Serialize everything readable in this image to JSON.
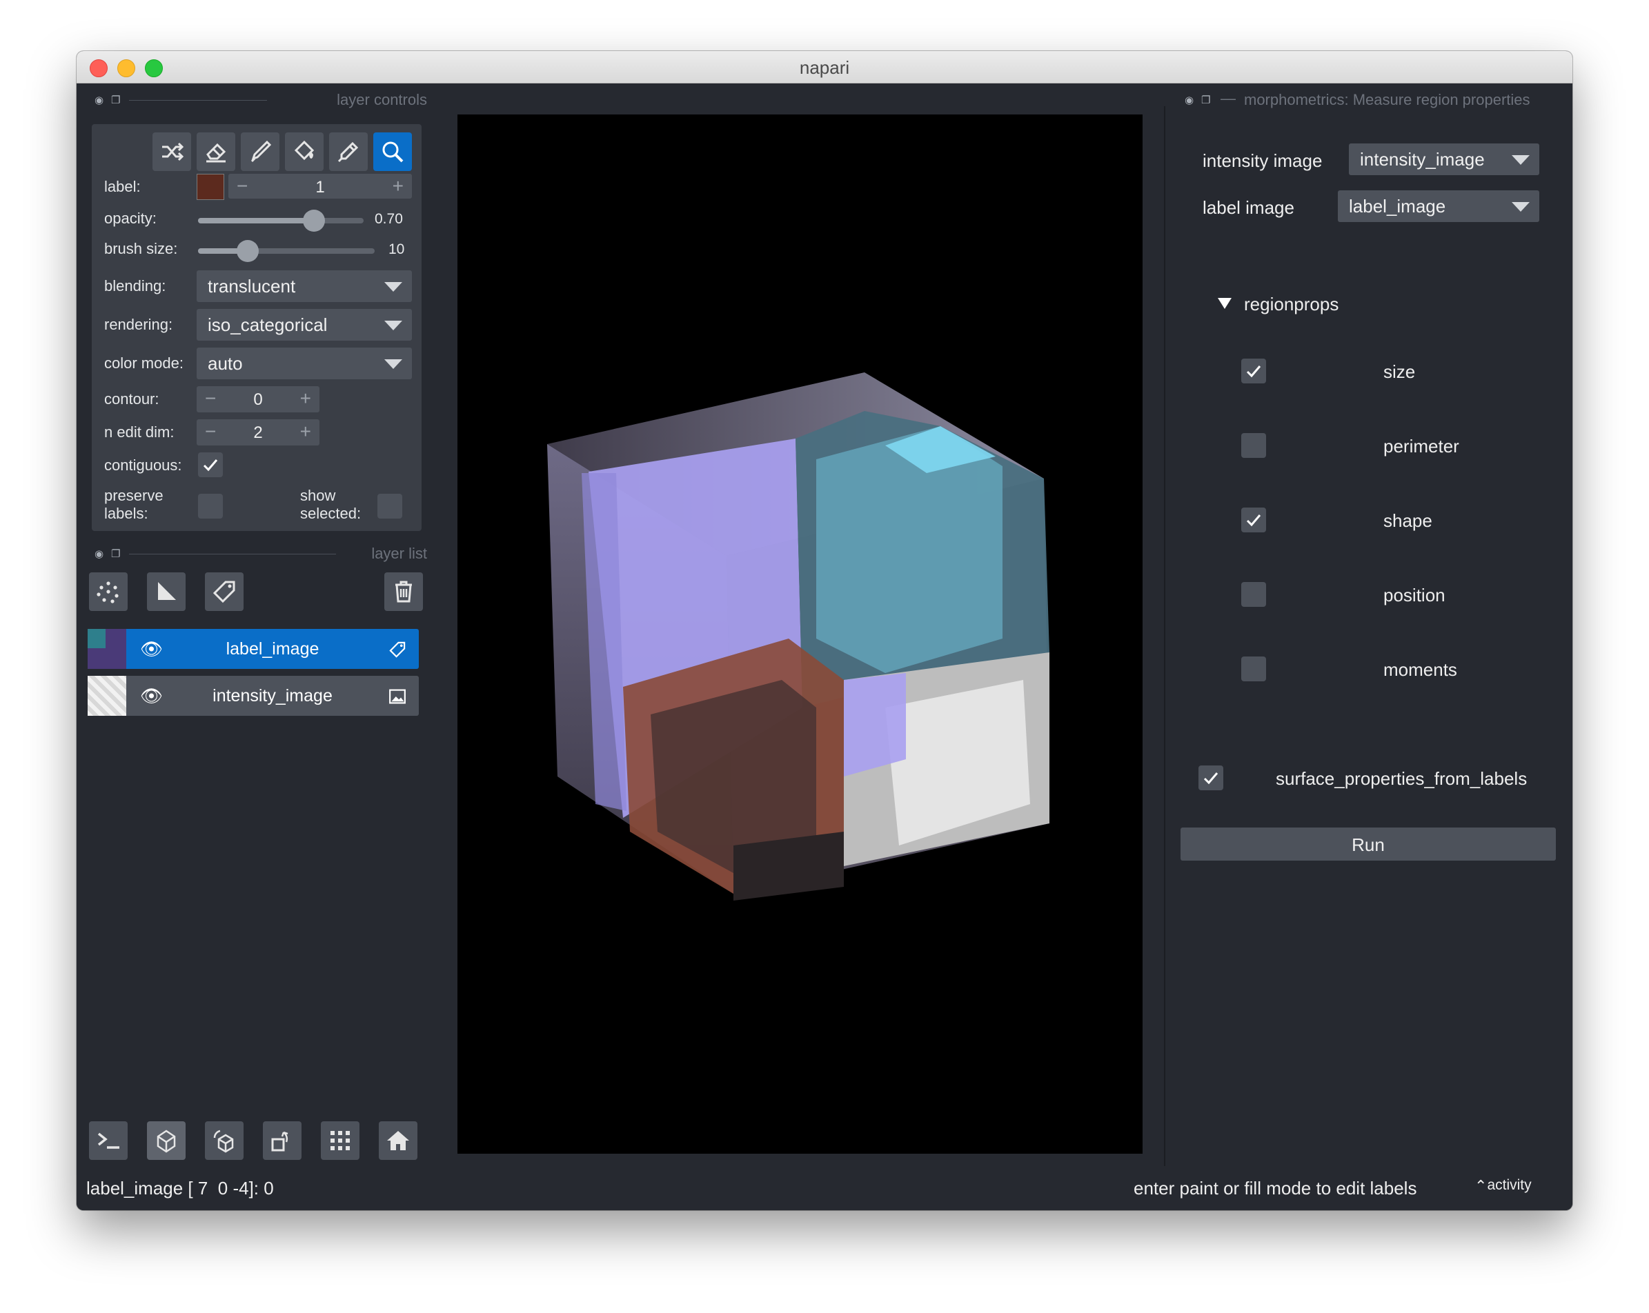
{
  "window": {
    "title": "napari"
  },
  "layer_controls": {
    "title": "layer controls",
    "label_row": {
      "label": "label:",
      "value": "1",
      "color": "#5c2a1e"
    },
    "opacity": {
      "label": "opacity:",
      "value": "0.70",
      "fraction": 0.7
    },
    "brush_size": {
      "label": "brush size:",
      "value": "10",
      "fraction": 0.28
    },
    "blending": {
      "label": "blending:",
      "value": "translucent"
    },
    "rendering": {
      "label": "rendering:",
      "value": "iso_categorical"
    },
    "color_mode": {
      "label": "color mode:",
      "value": "auto"
    },
    "contour": {
      "label": "contour:",
      "value": "0"
    },
    "n_edit_dim": {
      "label": "n edit dim:",
      "value": "2"
    },
    "contiguous": {
      "label": "contiguous:",
      "checked": true
    },
    "preserve_labels": {
      "label": "preserve labels:",
      "checked": false
    },
    "show_selected": {
      "label": "show selected:",
      "checked": false
    },
    "tools": [
      "shuffle-icon",
      "eraser-icon",
      "paint-brush-icon",
      "fill-bucket-icon",
      "color-picker-icon",
      "zoom-icon"
    ],
    "active_tool": "zoom-icon"
  },
  "layer_list": {
    "title": "layer list",
    "layers": [
      {
        "name": "label_image",
        "type": "labels",
        "visible": true,
        "selected": true
      },
      {
        "name": "intensity_image",
        "type": "image",
        "visible": true,
        "selected": false
      }
    ]
  },
  "morphometrics": {
    "title": "morphometrics: Measure region properties",
    "intensity_image": {
      "label": "intensity image",
      "value": "intensity_image"
    },
    "label_image": {
      "label": "label image",
      "value": "label_image"
    },
    "regionprops": {
      "title": "regionprops",
      "items": [
        {
          "label": "size",
          "checked": true
        },
        {
          "label": "perimeter",
          "checked": false
        },
        {
          "label": "shape",
          "checked": true
        },
        {
          "label": "position",
          "checked": false
        },
        {
          "label": "moments",
          "checked": false
        }
      ]
    },
    "surface": {
      "label": "surface_properties_from_labels",
      "checked": true
    },
    "run_label": "Run"
  },
  "status": {
    "left": "label_image [ 7  0 -4]: 0",
    "right": "enter paint or fill mode to edit labels",
    "activity": "activity"
  },
  "colors": {
    "accent": "#0a6ec8",
    "window_bg": "#262930",
    "panel_bg": "#3a3e46"
  }
}
